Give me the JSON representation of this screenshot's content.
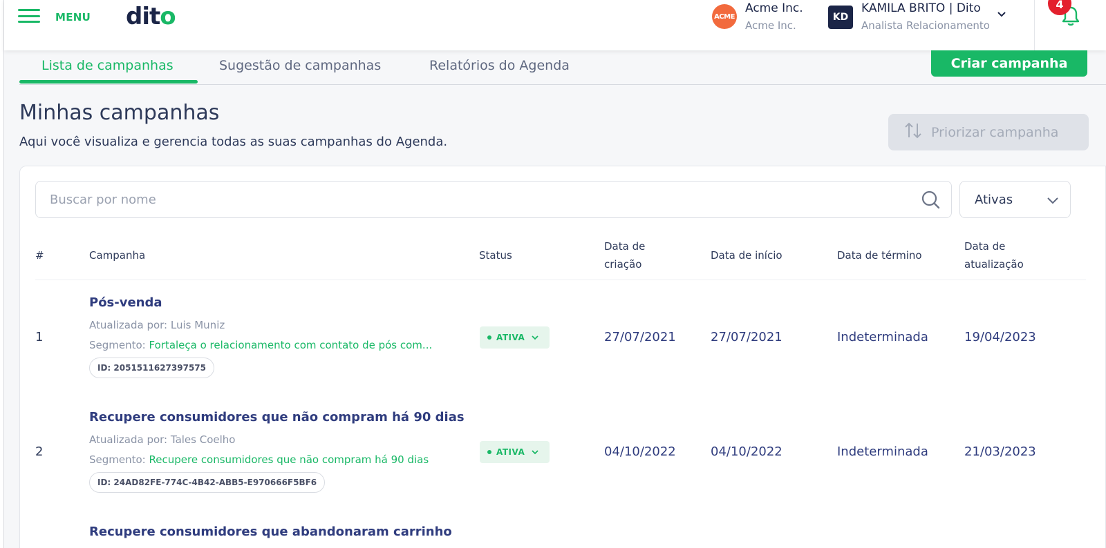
{
  "header": {
    "menu_label": "MENU",
    "logo_text": "dit",
    "logo_dot": "o",
    "account": {
      "logo_text": "ACME",
      "name": "Acme Inc.",
      "sub": "Acme Inc."
    },
    "user": {
      "initials": "KD",
      "name": "KAMILA BRITO | Dito",
      "role": "Analista Relacionamento"
    },
    "notifications_count": "4",
    "accent_color": "#19b866",
    "badge_color": "#e3202d"
  },
  "tabs": [
    {
      "label": "Lista de campanhas",
      "active": true
    },
    {
      "label": "Sugestão de campanhas",
      "active": false
    },
    {
      "label": "Relatórios do Agenda",
      "active": false
    }
  ],
  "create_button": "Criar campanha",
  "page": {
    "title": "Minhas campanhas",
    "subtitle": "Aqui você visualiza e gerencia todas as suas campanhas do Agenda.",
    "prioritize_button": "Priorizar campanha"
  },
  "search": {
    "placeholder": "Buscar por nome",
    "value": ""
  },
  "filter": {
    "selected": "Ativas"
  },
  "table": {
    "columns": {
      "num": "#",
      "campaign": "Campanha",
      "status": "Status",
      "created_1": "Data de",
      "created_2": "criação",
      "start": "Data de início",
      "end": "Data de término",
      "updated_1": "Data de",
      "updated_2": "atualização"
    },
    "rows": [
      {
        "num": "1",
        "name": "Pós-venda",
        "updated_by": "Atualizada por: Luis Muniz",
        "segment_label": "Segmento: ",
        "segment_value": "Fortaleça o relacionamento com contato de pós com...",
        "id": "ID: 2051511627397575",
        "status": "ATIVA",
        "created": "27/07/2021",
        "start": "27/07/2021",
        "end": "Indeterminada",
        "updated": "19/04/2023"
      },
      {
        "num": "2",
        "name": "Recupere consumidores que não compram há 90 dias",
        "updated_by": "Atualizada por: Tales Coelho",
        "segment_label": "Segmento: ",
        "segment_value": "Recupere consumidores que não compram há 90 dias",
        "id": "ID: 24AD82FE-774C-4B42-ABB5-E970666F5BF6",
        "status": "ATIVA",
        "created": "04/10/2022",
        "start": "04/10/2022",
        "end": "Indeterminada",
        "updated": "21/03/2023"
      },
      {
        "name": "Recupere consumidores que abandonaram carrinho"
      }
    ]
  }
}
